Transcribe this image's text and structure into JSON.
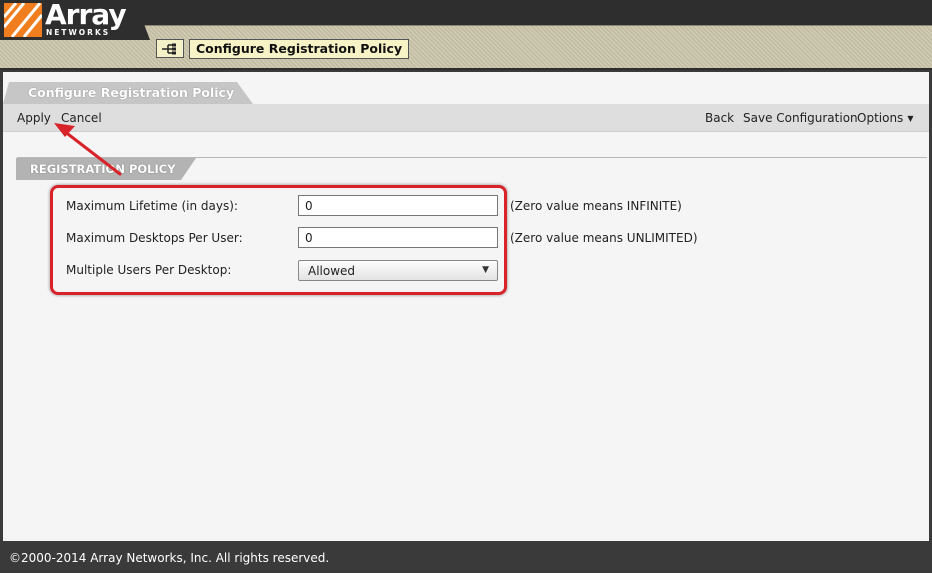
{
  "header": {
    "logo_text": "Array",
    "logo_subtext": "NETWORKS",
    "page_icon": "network-tree-icon",
    "page_title": "Configure Registration Policy"
  },
  "main": {
    "tab_title": "Configure Registration Policy",
    "toolbar": {
      "apply": "Apply",
      "cancel": "Cancel",
      "back": "Back",
      "save_configuration": "Save Configuration",
      "options": "Options"
    },
    "section": {
      "title": "REGISTRATION POLICY",
      "fields": {
        "max_lifetime": {
          "label": "Maximum Lifetime (in days):",
          "value": "0",
          "hint": "(Zero value means INFINITE)"
        },
        "max_desktops": {
          "label": "Maximum Desktops Per User:",
          "value": "0",
          "hint": "(Zero value means UNLIMITED)"
        },
        "multiple_users": {
          "label": "Multiple Users Per Desktop:",
          "selected": "Allowed"
        }
      }
    }
  },
  "footer": {
    "copyright": "©2000-2014 Array Networks, Inc. All rights reserved."
  },
  "colors": {
    "annotation": "#d8232a",
    "logo_orange": "#f07d1e",
    "header_band": "#cfcab0",
    "title_box": "#f7f3c6"
  }
}
